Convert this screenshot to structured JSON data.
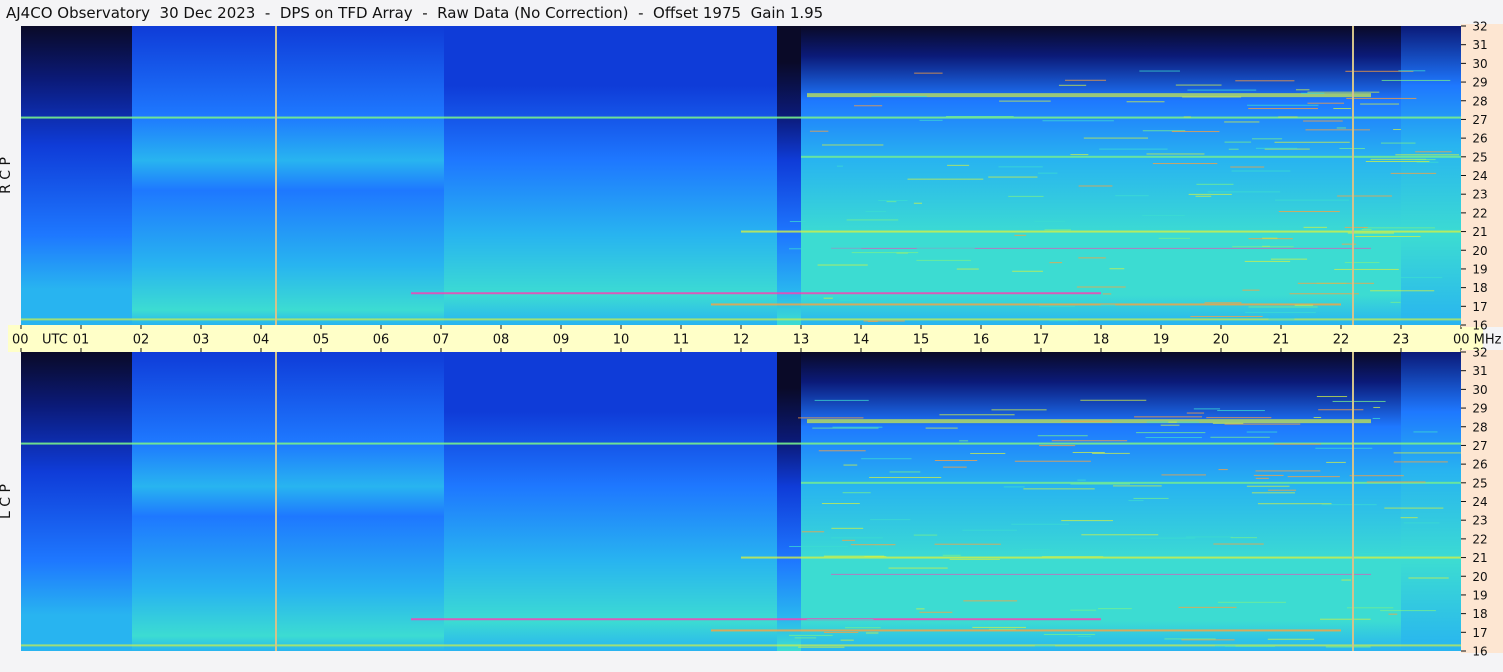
{
  "title": "AJ4CO Observatory  30 Dec 2023  -  DPS on TFD Array  -  Raw Data (No Correction)  -  Offset 1975  Gain 1.95",
  "colors": {
    "background": "#f4f4f6",
    "time_bar": "#ffffc8",
    "freq_bar": "#fde6d2",
    "colormap": [
      "#0a0a28",
      "#0b1a78",
      "#0f3cd8",
      "#1e78ff",
      "#28b4f0",
      "#3cdcd2",
      "#78f08c",
      "#d2f046",
      "#ffa03c",
      "#ff3cb4"
    ],
    "marker_line": "#d2c38c"
  },
  "chart_data": {
    "type": "heatmap",
    "panels": [
      {
        "label": "R C P",
        "ylim": [
          16,
          32
        ]
      },
      {
        "label": "L C P",
        "ylim": [
          16,
          32
        ]
      }
    ],
    "x_axis": {
      "unit_label": "UTC",
      "end_label": "00 MHz",
      "xlim": [
        0,
        24
      ],
      "ticks": [
        "00",
        "01",
        "02",
        "03",
        "04",
        "05",
        "06",
        "07",
        "08",
        "09",
        "10",
        "11",
        "12",
        "13",
        "14",
        "15",
        "16",
        "17",
        "18",
        "19",
        "20",
        "21",
        "22",
        "23",
        "00"
      ]
    },
    "y_axis": {
      "unit": "MHz",
      "ticks": [
        32,
        31,
        30,
        29,
        28,
        27,
        26,
        25,
        24,
        23,
        22,
        21,
        20,
        19,
        18,
        17,
        16
      ]
    },
    "markers_utc": [
      4.25,
      22.2
    ]
  }
}
